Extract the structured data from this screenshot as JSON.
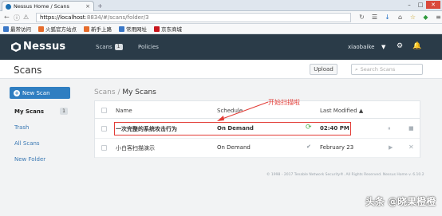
{
  "browser": {
    "tab_title": "Nessus Home / Scans",
    "new_tab": "+",
    "url_host": "https://localhost",
    "url_rest": ":8834/#/scans/folder/3",
    "bookmarks": [
      {
        "label": "最常访问",
        "color": "#3b78c7"
      },
      {
        "label": "火狐官方站点",
        "color": "#e66c2c"
      },
      {
        "label": "新手上路",
        "color": "#e66c2c"
      },
      {
        "label": "常用网址",
        "color": "#3b78c7"
      },
      {
        "label": "京东商城",
        "color": "#c8161d"
      }
    ]
  },
  "header": {
    "logo": "Nessus",
    "nav_scans": "Scans",
    "nav_scans_count": "1",
    "nav_policies": "Policies",
    "user": "xiaobaike"
  },
  "subheader": {
    "title": "Scans",
    "upload": "Upload",
    "search_placeholder": "Search Scans"
  },
  "sidebar": {
    "new_scan": "New Scan",
    "my_scans": "My Scans",
    "my_scans_count": "1",
    "trash": "Trash",
    "all_scans": "All Scans",
    "new_folder": "New Folder"
  },
  "main": {
    "breadcrumb_root": "Scans",
    "breadcrumb_sep": " / ",
    "breadcrumb_current": "My Scans",
    "col_name": "Name",
    "col_schedule": "Schedule",
    "col_last_modified": "Last Modified",
    "rows": [
      {
        "name": "一次完整的系统攻击行为",
        "schedule": "On Demand",
        "modified": "02:40 PM",
        "status": "running"
      },
      {
        "name": "小白客扫描演示",
        "schedule": "On Demand",
        "modified": "February 23",
        "status": "completed"
      }
    ],
    "annotation": "开始扫描啦",
    "footer": "© 1998 - 2017 Tenable Network Security®. All Rights Reserved. Nessus Home v. 6.10.2"
  },
  "watermark": "头条 @晓果橙橙",
  "colors": {
    "header_bg": "#2a3b48",
    "accent": "#2f7ec1",
    "highlight": "#e23b35",
    "running": "#4caf50"
  }
}
